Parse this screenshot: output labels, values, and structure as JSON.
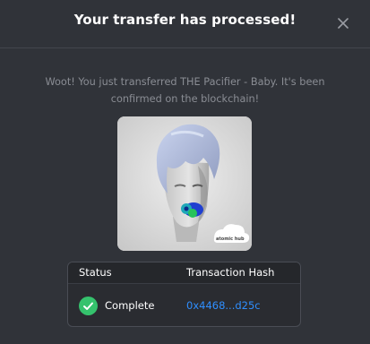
{
  "modal": {
    "title": "Your transfer has processed!",
    "close_icon": "close-icon",
    "message": "Woot! You just transferred THE Pacifier - Baby. It's been confirmed on the blockchain!"
  },
  "nft": {
    "watermark": "atomic hub"
  },
  "table": {
    "headers": {
      "status": "Status",
      "hash": "Transaction Hash"
    },
    "row": {
      "status": "Complete",
      "status_icon": "check-circle-icon",
      "hash": "0x4468...d25c"
    }
  },
  "colors": {
    "success": "#35c26d",
    "link": "#2f8fff",
    "background": "#303339"
  }
}
